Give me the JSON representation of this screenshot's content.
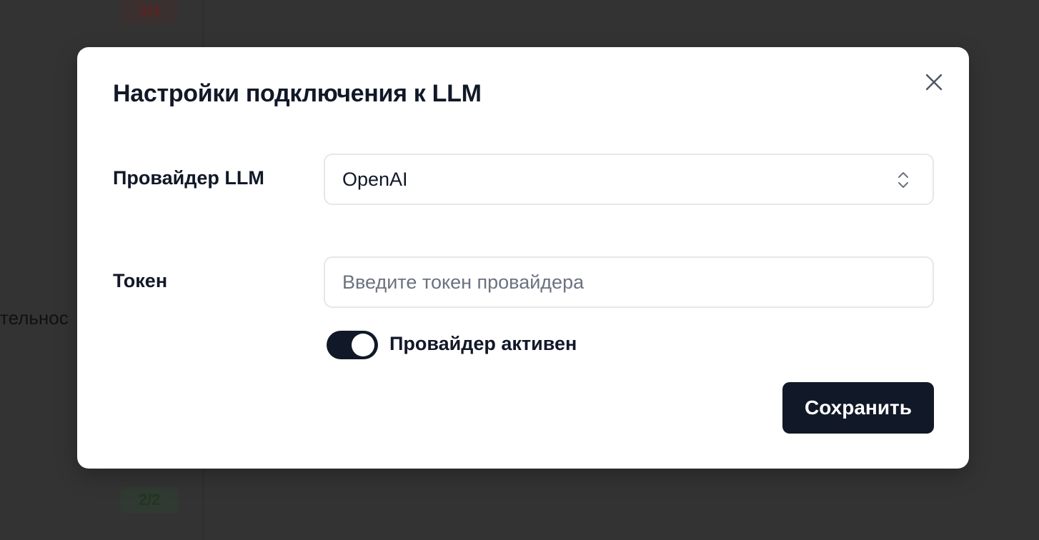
{
  "background": {
    "badge_top": "3/4",
    "badge_bottom": "2/2",
    "partial_text": "тельнос"
  },
  "modal": {
    "title": "Настройки подключения к LLM",
    "close_icon": "close-icon",
    "provider": {
      "label": "Провайдер LLM",
      "selected": "OpenAI",
      "chevron_icon": "chevron-up-down-icon"
    },
    "token": {
      "label": "Токен",
      "value": "",
      "placeholder": "Введите токен провайдера"
    },
    "active_toggle": {
      "label": "Провайдер активен",
      "checked": true
    },
    "save_label": "Сохранить"
  },
  "colors": {
    "overlay": "#333333",
    "primary": "#111827",
    "border": "#e5e7eb",
    "placeholder": "#6b7280"
  }
}
